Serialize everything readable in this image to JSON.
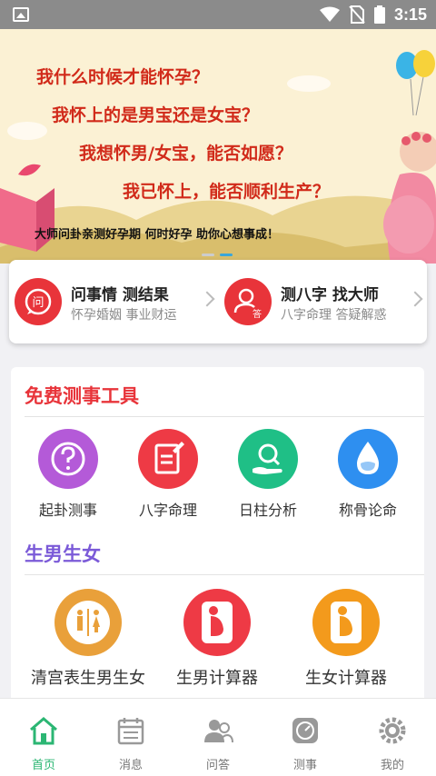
{
  "status_bar": {
    "time": "3:15"
  },
  "banner": {
    "lines": [
      "我什么时候才能怀孕？",
      "我怀上的是男宝还是女宝？",
      "我想怀男/女宝，能否如愿？",
      "我已怀上，能否顺利生产？"
    ],
    "bottom_text": "大师问卦亲测好孕期  何时好孕    助你心想事成！",
    "slide_count": 2,
    "active_slide": 2
  },
  "quick_card": [
    {
      "title": "问事情 测结果",
      "subtitle": "怀孕婚姻 事业财运",
      "icon": "question-chat-icon",
      "icon_char": "问"
    },
    {
      "title": "测八字 找大师",
      "subtitle": "八字命理 答疑解惑",
      "icon": "master-answer-icon",
      "icon_char": "答"
    }
  ],
  "free_tools": {
    "title": "免费测事工具",
    "title_color": "#e8343a",
    "items": [
      {
        "label": "起卦测事",
        "icon": "question-mark-icon",
        "color": "#b45ad8"
      },
      {
        "label": "八字命理",
        "icon": "edit-document-icon",
        "color": "#ee3a45"
      },
      {
        "label": "日柱分析",
        "icon": "magnifier-hand-icon",
        "color": "#1fbf86"
      },
      {
        "label": "称骨论命",
        "icon": "water-drop-icon",
        "color": "#2e8ff0"
      }
    ]
  },
  "gender": {
    "title": "生男生女",
    "title_color": "#7b5ad8",
    "items": [
      {
        "label": "清宫表生男生女",
        "icon": "restroom-icon",
        "color": "#e9a03a"
      },
      {
        "label": "生男计算器",
        "icon": "pregnant-icon",
        "color": "#ee3a45"
      },
      {
        "label": "生女计算器",
        "icon": "pregnant-icon",
        "color": "#f39a1c"
      }
    ]
  },
  "bottom_nav": [
    {
      "label": "首页",
      "icon": "home-icon",
      "active": true
    },
    {
      "label": "消息",
      "icon": "calendar-icon",
      "active": false
    },
    {
      "label": "问答",
      "icon": "users-icon",
      "active": false
    },
    {
      "label": "测事",
      "icon": "dial-icon",
      "active": false
    },
    {
      "label": "我的",
      "icon": "gear-icon",
      "active": false
    }
  ],
  "colors": {
    "accent": "#2bb673",
    "inactive": "#999999"
  }
}
